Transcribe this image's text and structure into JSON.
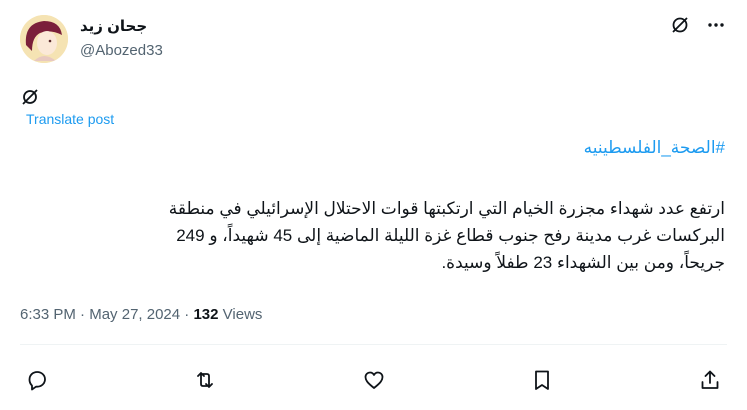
{
  "author": {
    "display_name": "جحان زيد",
    "handle": "@Abozed33"
  },
  "header_icons": {
    "grok": "grok-icon",
    "more": "more-icon"
  },
  "translate": {
    "icon": "language-icon",
    "label": "Translate post"
  },
  "post": {
    "hashtag": "#الصحة_الفلسطينيه",
    "lines": [
      "ارتفع عدد شهداء مجزرة الخيام التي ارتكبتها قوات الاحتلال الإسرائيلي في منطقة",
      "البركسات غرب مدينة رفح جنوب قطاع غزة الليلة الماضية إلى 45 شهيداً، و 249",
      "جريحاً، ومن بين الشهداء 23 طفلاً وسيدة."
    ]
  },
  "meta": {
    "time": "6:33 PM",
    "separator": " · ",
    "date": "May 27, 2024",
    "views_count": "132",
    "views_label": " Views"
  },
  "actions": [
    {
      "name": "reply",
      "icon": "reply-icon"
    },
    {
      "name": "repost",
      "icon": "repost-icon"
    },
    {
      "name": "like",
      "icon": "like-icon"
    },
    {
      "name": "bookmark",
      "icon": "bookmark-icon"
    },
    {
      "name": "share",
      "icon": "share-icon"
    }
  ],
  "colors": {
    "link": "#1d9bf0",
    "secondary_text": "#536471",
    "primary_text": "#0f1419"
  }
}
